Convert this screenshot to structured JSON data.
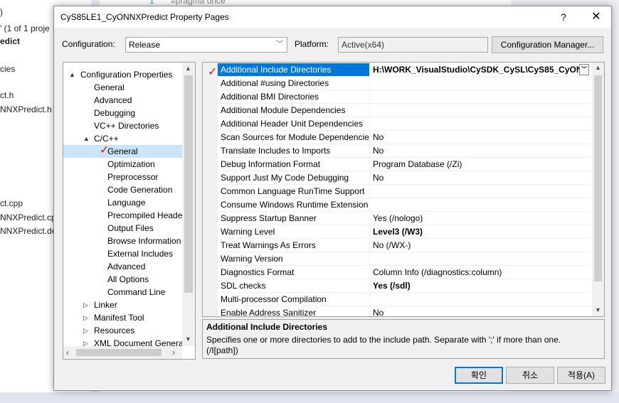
{
  "background": {
    "left_items": [
      ")",
      "' (1 of 1 proje",
      "edict",
      "cies",
      "ct.h",
      "NNXPredict.h",
      "ct.cpp",
      "NNXPredict.cpp",
      "NNXPredict.def"
    ],
    "editor_snippet": "#pragma once",
    "editor_line": "1"
  },
  "dialog": {
    "title": "CyS85LE1_CyONNXPredict Property Pages",
    "help_label": "?",
    "close_label": "✕"
  },
  "config": {
    "configuration_label": "Configuration:",
    "configuration_value": "Release",
    "platform_label": "Platform:",
    "platform_value": "Active(x64)",
    "manager_button": "Configuration Manager..."
  },
  "tree": {
    "items": [
      {
        "label": "Configuration Properties",
        "toggle": "▲"
      },
      {
        "label": "General",
        "toggle": ""
      },
      {
        "label": "Advanced",
        "toggle": ""
      },
      {
        "label": "Debugging",
        "toggle": ""
      },
      {
        "label": "VC++ Directories",
        "toggle": ""
      },
      {
        "label": "C/C++",
        "toggle": "▲"
      },
      {
        "label": "General",
        "toggle": ""
      },
      {
        "label": "Optimization",
        "toggle": ""
      },
      {
        "label": "Preprocessor",
        "toggle": ""
      },
      {
        "label": "Code Generation",
        "toggle": ""
      },
      {
        "label": "Language",
        "toggle": ""
      },
      {
        "label": "Precompiled Heade",
        "toggle": ""
      },
      {
        "label": "Output Files",
        "toggle": ""
      },
      {
        "label": "Browse Information",
        "toggle": ""
      },
      {
        "label": "External Includes",
        "toggle": ""
      },
      {
        "label": "Advanced",
        "toggle": ""
      },
      {
        "label": "All Options",
        "toggle": ""
      },
      {
        "label": "Command Line",
        "toggle": ""
      },
      {
        "label": "Linker",
        "toggle": "▷"
      },
      {
        "label": "Manifest Tool",
        "toggle": "▷"
      },
      {
        "label": "Resources",
        "toggle": "▷"
      },
      {
        "label": "XML Document Genera",
        "toggle": "▷"
      }
    ]
  },
  "grid": {
    "rows": [
      {
        "name": "Additional Include Directories",
        "value": "H:\\WORK_VisualStudio\\CySDK_CySL\\CyS85_CyON",
        "bold": true
      },
      {
        "name": "Additional #using Directories",
        "value": "",
        "bold": false
      },
      {
        "name": "Additional BMI Directories",
        "value": "",
        "bold": false
      },
      {
        "name": "Additional Module Dependencies",
        "value": "",
        "bold": false
      },
      {
        "name": "Additional Header Unit Dependencies",
        "value": "",
        "bold": false
      },
      {
        "name": "Scan Sources for Module Dependencie",
        "value": "No",
        "bold": false
      },
      {
        "name": "Translate Includes to Imports",
        "value": "No",
        "bold": false
      },
      {
        "name": "Debug Information Format",
        "value": "Program Database (/Zi)",
        "bold": false
      },
      {
        "name": "Support Just My Code Debugging",
        "value": "No",
        "bold": false
      },
      {
        "name": "Common Language RunTime Support",
        "value": "",
        "bold": false
      },
      {
        "name": "Consume Windows Runtime Extension",
        "value": "",
        "bold": false
      },
      {
        "name": "Suppress Startup Banner",
        "value": "Yes (/nologo)",
        "bold": false
      },
      {
        "name": "Warning Level",
        "value": "Level3 (/W3)",
        "bold": true
      },
      {
        "name": "Treat Warnings As Errors",
        "value": "No (/WX-)",
        "bold": false
      },
      {
        "name": "Warning Version",
        "value": "",
        "bold": false
      },
      {
        "name": "Diagnostics Format",
        "value": "Column Info (/diagnostics:column)",
        "bold": false
      },
      {
        "name": "SDL checks",
        "value": "Yes (/sdl)",
        "bold": true
      },
      {
        "name": "Multi-processor Compilation",
        "value": "",
        "bold": false
      },
      {
        "name": "Enable Address Sanitizer",
        "value": "No",
        "bold": false
      }
    ]
  },
  "description": {
    "title": "Additional Include Directories",
    "text": "Specifies one or more directories to add to the include path. Separate with ';' if more than one. (/I[path])"
  },
  "buttons": {
    "ok": "확인",
    "cancel": "취소",
    "apply": "적용(A)"
  },
  "colors": {
    "selection": "#0078d7",
    "tree_selection": "#cce4f7",
    "annotation": "#e01010"
  }
}
